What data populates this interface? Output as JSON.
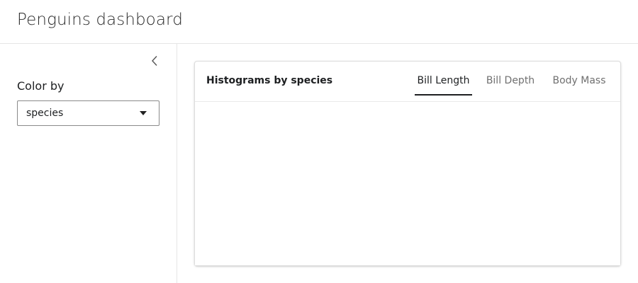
{
  "header": {
    "title": "Penguins dashboard"
  },
  "sidebar": {
    "collapse_icon": "chevron-left-icon",
    "color_by_label": "Color by",
    "color_by_select": {
      "value": "species",
      "caret_icon": "caret-down-icon"
    }
  },
  "card": {
    "title": "Histograms by species",
    "tabs": [
      {
        "label": "Bill Length",
        "active": true
      },
      {
        "label": "Bill Depth",
        "active": false
      },
      {
        "label": "Body Mass",
        "active": false
      }
    ]
  }
}
